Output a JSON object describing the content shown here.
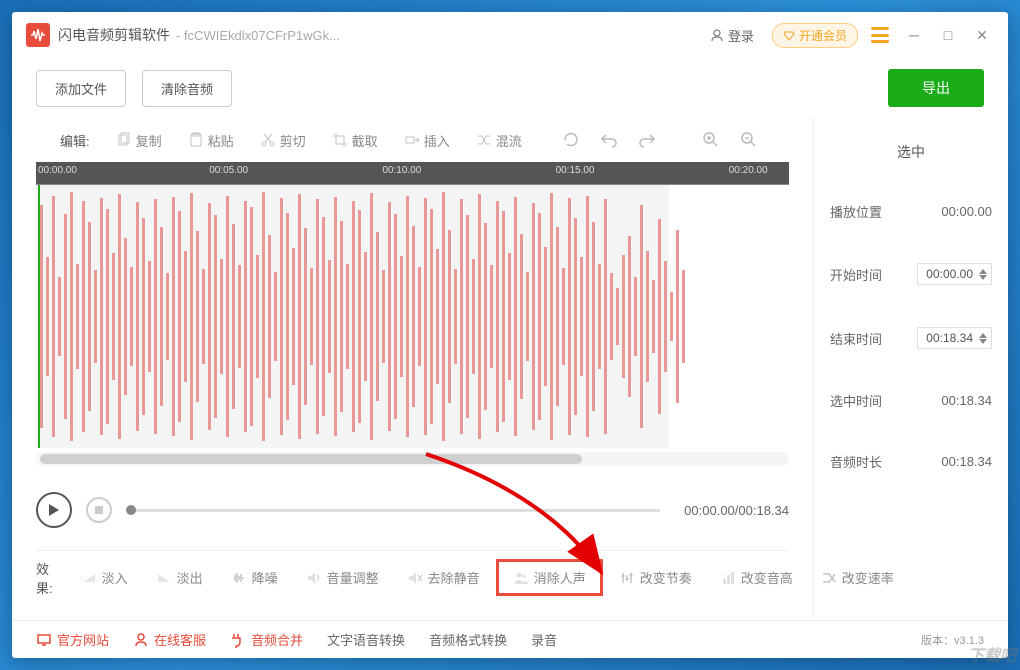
{
  "app": {
    "title": "闪电音频剪辑软件",
    "file": "- fcCWIEkdlx07CFrP1wGk..."
  },
  "titlebar": {
    "login": "登录",
    "vip": "开通会员"
  },
  "topbar": {
    "add": "添加文件",
    "clear": "清除音频",
    "export": "导出"
  },
  "toolbar": {
    "label": "编辑:",
    "copy": "复制",
    "paste": "粘贴",
    "cut": "剪切",
    "crop": "截取",
    "insert": "插入",
    "mix": "混流",
    "selected": "选中"
  },
  "ruler": {
    "t0": "00:00.00",
    "t1": "00:05.00",
    "t2": "00:10.00",
    "t3": "00:15.00",
    "t4": "00:20.00"
  },
  "player": {
    "time": "00:00.00/00:18.34"
  },
  "effects": {
    "label": "效果:",
    "fadein": "淡入",
    "fadeout": "淡出",
    "denoise": "降噪",
    "volume": "音量调整",
    "silence": "去除静音",
    "vocal": "消除人声",
    "tempo": "改变节奏",
    "pitch": "改变音高",
    "speed": "改变速率"
  },
  "sidebar": {
    "head": "选中",
    "pos_l": "播放位置",
    "pos_v": "00:00.00",
    "start_l": "开始时间",
    "start_v": "00:00.00",
    "end_l": "结束时间",
    "end_v": "00:18.34",
    "sel_l": "选中时间",
    "sel_v": "00:18.34",
    "dur_l": "音频时长",
    "dur_v": "00:18.34"
  },
  "footer": {
    "site": "官方网站",
    "service": "在线客服",
    "merge": "音频合并",
    "tts": "文字语音转换",
    "convert": "音频格式转换",
    "record": "录音",
    "version": "版本：v3.1.3"
  },
  "watermark": "下载吧"
}
